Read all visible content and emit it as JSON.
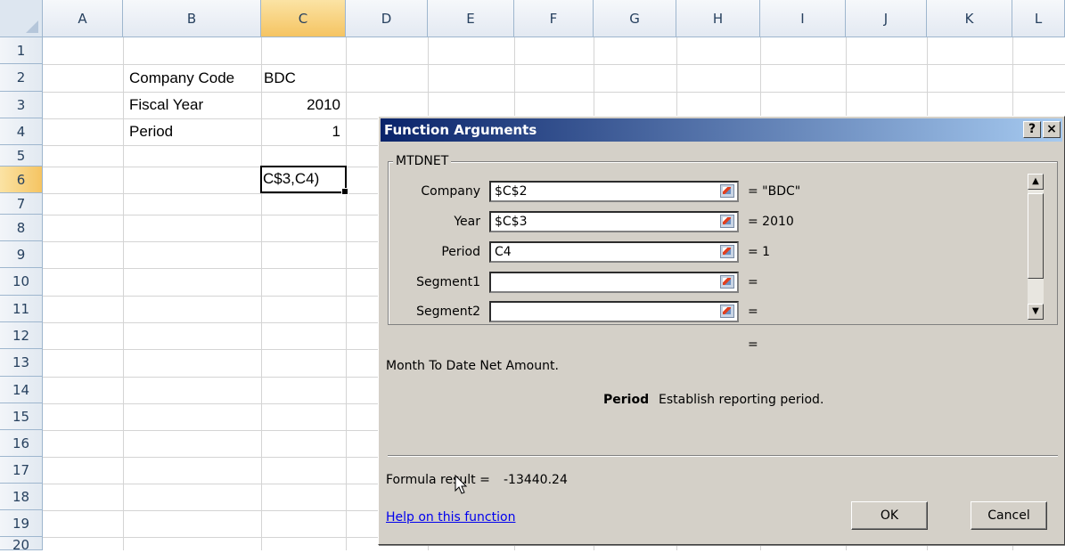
{
  "sheet": {
    "columns": [
      "A",
      "B",
      "C",
      "D",
      "E",
      "F",
      "G",
      "H",
      "I",
      "J",
      "K",
      "L"
    ],
    "rows": [
      "1",
      "2",
      "3",
      "4",
      "5",
      "6",
      "7",
      "8",
      "9",
      "10",
      "11",
      "12",
      "13",
      "14",
      "15",
      "16",
      "17",
      "18",
      "19",
      "20"
    ],
    "active_column": "C",
    "active_row": "6",
    "cells": {
      "b2": "Company Code",
      "c2": "BDC",
      "b3": "Fiscal Year",
      "c3": "2010",
      "b4": "Period",
      "c4": "1"
    },
    "active_cell_text": "C$3,C4)"
  },
  "dialog": {
    "title": "Function Arguments",
    "help_button": "?",
    "close_button": "×",
    "function_name": "MTDNET",
    "args": [
      {
        "label": "Company",
        "value": "$C$2",
        "result": "=  \"BDC\""
      },
      {
        "label": "Year",
        "value": "$C$3",
        "result": "=  2010"
      },
      {
        "label": "Period",
        "value": "C4",
        "result": "=  1"
      },
      {
        "label": "Segment1",
        "value": "",
        "result": "="
      },
      {
        "label": "Segment2",
        "value": "",
        "result": "="
      }
    ],
    "overall_result": "=",
    "description": "Month To Date Net Amount.",
    "arg_name": "Period",
    "arg_description": "Establish reporting period.",
    "formula_result_label": "Formula result =",
    "formula_result_value": "-13440.24",
    "help_link": "Help on this function",
    "ok_label": "OK",
    "cancel_label": "Cancel"
  },
  "icons": [
    "collapse-dialog-icon",
    "scroll-up-arrow-icon",
    "scroll-down-arrow-icon",
    "mouse-pointer-icon"
  ]
}
